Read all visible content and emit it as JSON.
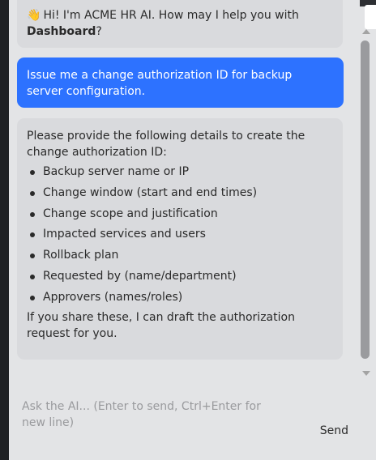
{
  "chat": {
    "greeting": {
      "emoji": "👋",
      "text_before": "Hi! I'm ACME HR AI. How may I help you with ",
      "context_bold": "Dashboard",
      "text_after": "?"
    },
    "user_message": "Issue me a change authorization ID for backup server configuration.",
    "assistant_reply": {
      "intro": "Please provide the following details to create the change authorization ID:",
      "items": [
        "Backup server name or IP",
        "Change window (start and end times)",
        "Change scope and justification",
        "Impacted services and users",
        "Rollback plan",
        "Requested by (name/department)",
        "Approvers (names/roles)"
      ],
      "outro": "If you share these, I can draft the authorization request for you."
    }
  },
  "composer": {
    "placeholder": "Ask the AI... (Enter to send, Ctrl+Enter for new line)",
    "send_label": "Send"
  },
  "colors": {
    "user_bubble": "#2d72ff",
    "assistant_bubble": "#d9dadd",
    "background": "#e3e4e6"
  }
}
